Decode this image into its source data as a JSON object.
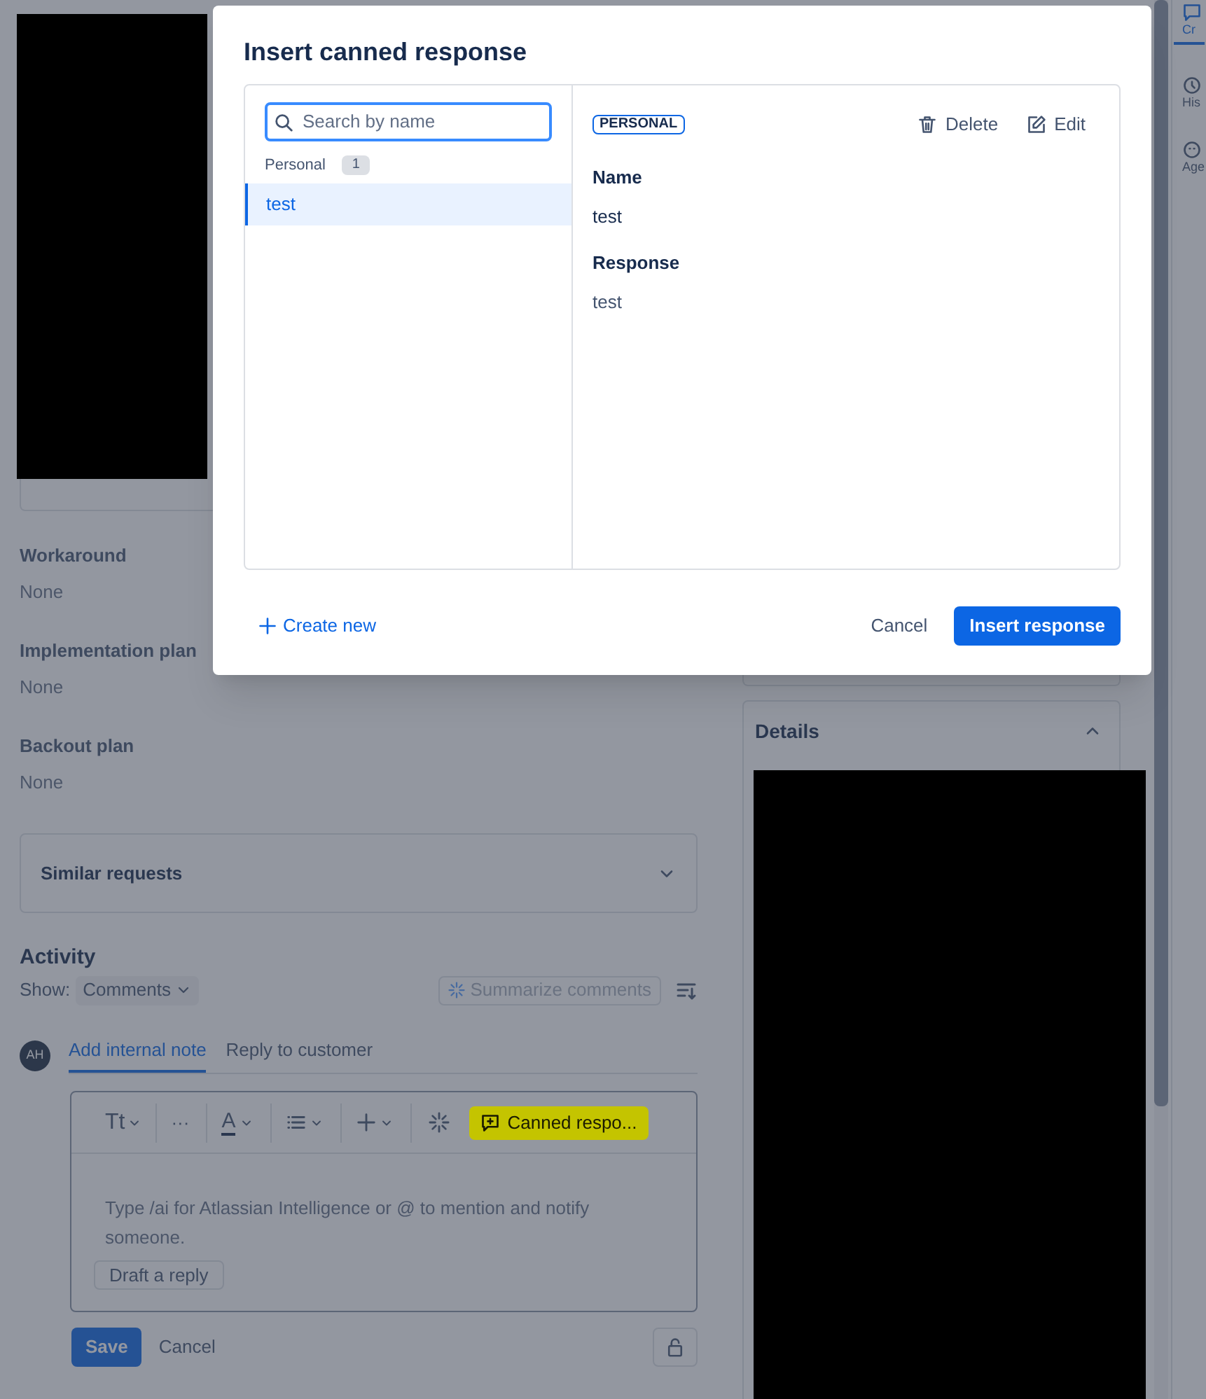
{
  "page": {
    "fields": [
      {
        "label": "Workaround",
        "value": "None"
      },
      {
        "label": "Implementation plan",
        "value": "None"
      },
      {
        "label": "Backout plan",
        "value": "None"
      }
    ],
    "similar_requests": {
      "label": "Similar requests",
      "expanded": false
    },
    "activity": {
      "title": "Activity",
      "show_label": "Show:",
      "filter": "Comments",
      "summarize": "Summarize comments",
      "avatar": "AH",
      "tabs": [
        {
          "label": "Add internal note",
          "selected": true
        },
        {
          "label": "Reply to customer",
          "selected": false
        }
      ],
      "toolbar": [
        {
          "kind": "text-style",
          "label": "Tt"
        },
        {
          "kind": "more",
          "label": "···"
        },
        {
          "kind": "text-color",
          "label": "A"
        },
        {
          "kind": "list"
        },
        {
          "kind": "insert"
        },
        {
          "kind": "ai"
        }
      ],
      "canned_button": {
        "label": "Canned respo...",
        "highlighted": true
      },
      "editor": {
        "placeholder": "Type /ai for Atlassian Intelligence or @ to mention and notify someone.",
        "draft_button": "Draft a reply"
      },
      "save": "Save",
      "cancel": "Cancel"
    },
    "details": {
      "title": "Details",
      "expanded": true
    },
    "side_rail": [
      {
        "label": "Cr",
        "selected": true
      },
      {
        "label": "His",
        "selected": false
      },
      {
        "label": "Age",
        "selected": false
      }
    ]
  },
  "dialog": {
    "title": "Insert canned response",
    "search": {
      "placeholder": "Search by name"
    },
    "groups": [
      {
        "label": "Personal",
        "count": "1",
        "items": [
          {
            "label": "test",
            "selected": true
          }
        ]
      }
    ],
    "detail": {
      "badge": "PERSONAL",
      "actions": [
        {
          "kind": "delete",
          "label": "Delete"
        },
        {
          "kind": "edit",
          "label": "Edit"
        }
      ],
      "fields": [
        {
          "label": "Name",
          "value": "test"
        },
        {
          "label": "Response",
          "value": "test"
        }
      ]
    },
    "create_new": "Create new",
    "buttons": [
      {
        "kind": "secondary",
        "label": "Cancel"
      },
      {
        "kind": "primary",
        "label": "Insert response"
      }
    ]
  }
}
